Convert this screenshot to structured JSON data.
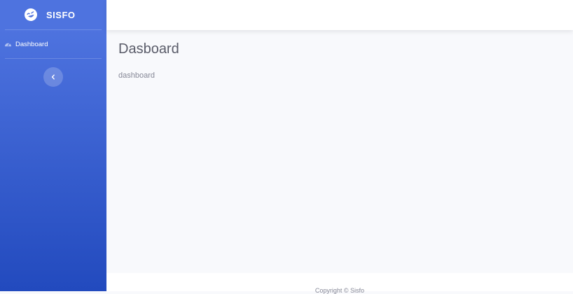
{
  "brand": {
    "name": "SISFO",
    "icon": "laugh-wink-icon"
  },
  "sidebar": {
    "items": [
      {
        "label": "Dashboard",
        "icon": "tachometer-icon"
      }
    ],
    "toggle_icon": "chevron-left-icon"
  },
  "main": {
    "title": "Dasboard",
    "text": "dashboard"
  },
  "footer": {
    "copyright": "Copyright © Sisfo"
  },
  "colors": {
    "sidebar_top": "#4e73df",
    "sidebar_bottom": "#224abe",
    "content_bg": "#f8f9fc",
    "title": "#5a5c69",
    "muted": "#858796"
  }
}
